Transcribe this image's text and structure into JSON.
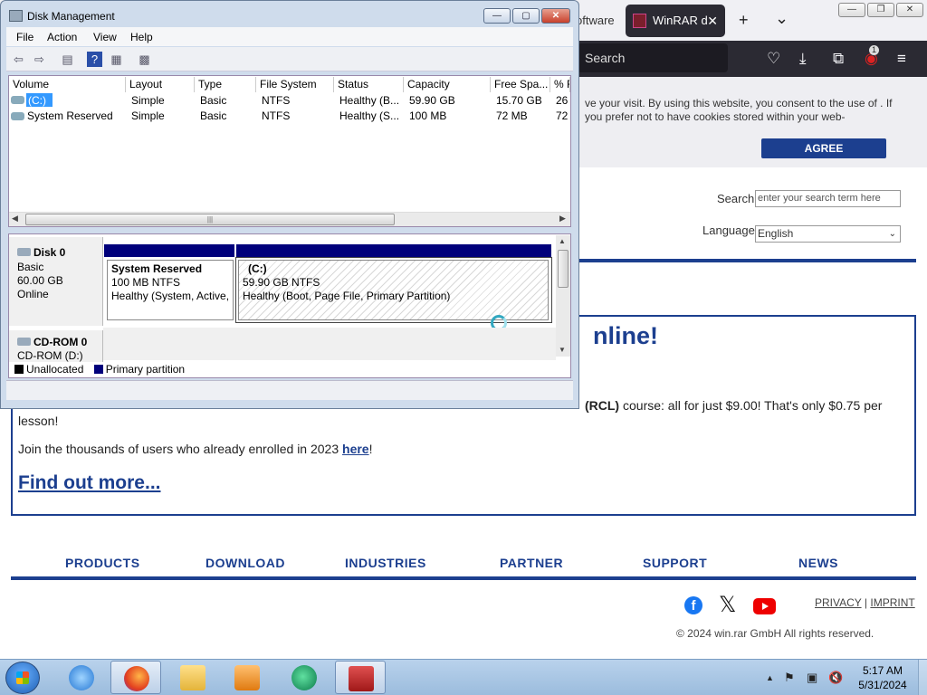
{
  "firefox": {
    "tab_inactive_label": "oftware",
    "tab_active_label": "WinRAR d",
    "tab_close": "✕",
    "new_tab": "+",
    "tab_list": "⌄",
    "search_placeholder": "Search",
    "extension_badge": "1",
    "window_minimize": "—",
    "window_restore": "❐",
    "window_close": "✕"
  },
  "site": {
    "cookie_text": "ve your visit. By using this website, you consent to the use of . If you prefer not to have cookies stored within your web-",
    "agree_label": "AGREE",
    "search_label": "Search",
    "search_placeholder": "enter your search term here",
    "language_label": "Language",
    "language_value": "English",
    "promo_title": "nline!",
    "promo_p1_strong": "(RCL)",
    "promo_p1_rest": " course: all for just $9.00! That's only $0.75 per",
    "promo_p1_cont": "lesson!",
    "promo_p2_text": "Join the thousands of users who already enrolled in 2023 ",
    "promo_p2_link": "here",
    "promo_p2_end": "!",
    "find_out": "Find out more...",
    "nav": [
      "PRODUCTS",
      "DOWNLOAD",
      "INDUSTRIES",
      "PARTNER",
      "SUPPORT",
      "NEWS"
    ],
    "privacy": "PRIVACY",
    "separator": " | ",
    "imprint": "IMPRINT",
    "copyright": "© 2024 win.rar GmbH All rights reserved."
  },
  "disk_mgmt": {
    "title": "Disk Management",
    "menu": [
      "File",
      "Action",
      "View",
      "Help"
    ],
    "columns": [
      "Volume",
      "Layout",
      "Type",
      "File System",
      "Status",
      "Capacity",
      "Free Spa...",
      "% F"
    ],
    "rows": [
      [
        "(C:)",
        "Simple",
        "Basic",
        "NTFS",
        "Healthy (B...",
        "59.90 GB",
        "15.70 GB",
        "26"
      ],
      [
        "System Reserved",
        "Simple",
        "Basic",
        "NTFS",
        "Healthy (S...",
        "100 MB",
        "72 MB",
        "72"
      ]
    ],
    "disk0": {
      "name": "Disk 0",
      "type": "Basic",
      "size": "60.00 GB",
      "state": "Online"
    },
    "part1": {
      "name": "System Reserved",
      "size": "100 MB NTFS",
      "status": "Healthy (System, Active,"
    },
    "part2": {
      "name": "(C:)",
      "size": "59.90 GB NTFS",
      "status": "Healthy (Boot, Page File, Primary Partition)"
    },
    "cdrom": {
      "name": "CD-ROM 0",
      "drive": "CD-ROM (D:)"
    },
    "legend": [
      "Unallocated",
      "Primary partition"
    ],
    "colors": {
      "unallocated": "#000000",
      "primary": "#00007b"
    }
  },
  "taskbar": {
    "time": "5:17 AM",
    "date": "5/31/2024",
    "apps": [
      "internet-explorer",
      "firefox",
      "file-explorer",
      "media-player",
      "app-green",
      "disk-management"
    ]
  }
}
